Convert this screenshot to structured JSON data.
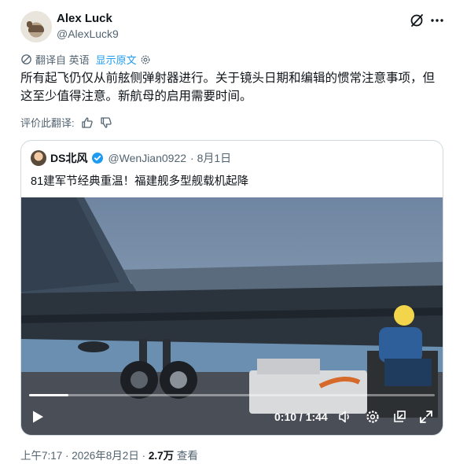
{
  "author": {
    "name": "Alex Luck",
    "handle": "@AlexLuck9"
  },
  "icons": {
    "grok": "grok-icon",
    "more": "more-horizontal-icon",
    "translate": "translate-icon",
    "settings": "gear-icon",
    "thumbs_up": "thumbs-up-icon",
    "thumbs_down": "thumbs-down-icon"
  },
  "translation": {
    "label": "翻译自 英语",
    "show_original": "显示原文"
  },
  "post": {
    "text": "所有起飞仍仅从前舷侧弹射器进行。关于镜头日期和编辑的惯常注意事项，但这至少值得注意。新航母的启用需要时间。"
  },
  "rate": {
    "label": "评价此翻译:"
  },
  "quote": {
    "name": "DS北风",
    "handle": "@WenJian0922",
    "date": "· 8月1日",
    "text": "81建军节经典重温！福建舰多型舰载机起降",
    "video": {
      "time": "0:10 / 1:44",
      "progress": 0.096
    }
  },
  "footer": {
    "time": "上午7:17 · 2026年8月2日 · ",
    "views": "2.7万",
    "views_label": " 查看"
  },
  "colors": {
    "link": "#1d9bf0",
    "muted": "#536471",
    "text": "#0f1419",
    "border": "#cfd9de"
  }
}
